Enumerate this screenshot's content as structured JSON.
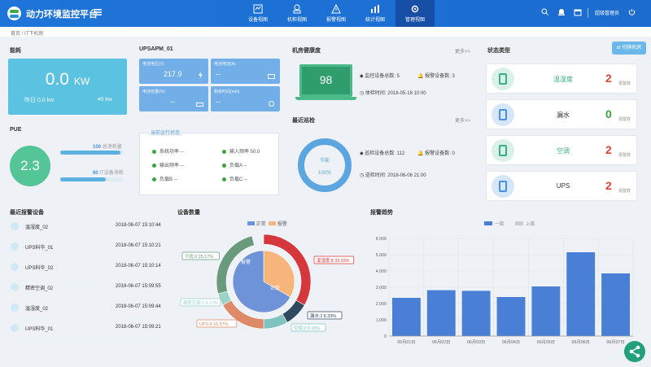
{
  "header": {
    "title": "动力环境监控平台",
    "user": "超级管理员",
    "nav": [
      {
        "label": "设备视图"
      },
      {
        "label": "机柜视图"
      },
      {
        "label": "报警视图"
      },
      {
        "label": "统计视图"
      },
      {
        "label": "管理视图"
      }
    ]
  },
  "breadcrumb": {
    "home": "首页",
    "current": "IT下机房"
  },
  "power": {
    "title": "能耗",
    "value": "0.0",
    "unit": "KW",
    "yesterday": "昨日 0.0 kw",
    "trend": "0 kw"
  },
  "pue": {
    "title": "PUE",
    "value": "2.3",
    "bar1_value": "100",
    "bar1_label": "总消耗量",
    "bar2_value": "80",
    "bar2_label": "IT设备消耗",
    "bar1_fill": 0.95,
    "bar2_fill": 0.72
  },
  "ups": {
    "title": "UPSAPM_01",
    "cells": [
      {
        "label": "电池电压(V)",
        "value": "217.9"
      },
      {
        "label": "电池电流(A)",
        "value": "--"
      },
      {
        "label": "电池容量(%)",
        "value": "--"
      },
      {
        "label": "剩余时间(min)",
        "value": "--"
      }
    ],
    "status_title": "当前运行状态",
    "status": [
      "系统功率 --",
      "输入频率 50.0",
      "输出频率 --",
      "负载A --",
      "负载B --",
      "负载C --"
    ]
  },
  "health": {
    "title": "机房健康度",
    "more": "更多>>",
    "score": "98",
    "monitor": "监控设备总数: 5",
    "alarm": "报警设备数: 3",
    "time": "体检时间: 2018-05-18 10:00"
  },
  "inspect": {
    "title": "最近巡检",
    "more": "更多>>",
    "center_label": "节能",
    "score": "100分",
    "total": "巡检设备总数: 112",
    "alarm": "报警设备数: 0",
    "time": "巡检时间: 2018-06-06 21:00"
  },
  "status": {
    "title": "状态类型",
    "switch": "切换机房",
    "items": [
      {
        "label": "温湿度",
        "count": "2",
        "unit": "报警数",
        "color": "#e3413a"
      },
      {
        "label": "漏水",
        "count": "0",
        "unit": "报警数",
        "color": "#3ba53b"
      },
      {
        "label": "空调",
        "count": "2",
        "unit": "报警数",
        "color": "#e3413a"
      },
      {
        "label": "UPS",
        "count": "2",
        "unit": "报警数",
        "color": "#e3413a"
      }
    ]
  },
  "alarms": {
    "title": "最近报警设备",
    "rows": [
      {
        "name": "温湿度_02",
        "time": "2018-06-07 15:10:44"
      },
      {
        "name": "UPS科华_01",
        "time": "2018-06-07 15:10:21"
      },
      {
        "name": "UPS科华_02",
        "time": "2018-06-07 15:10:14"
      },
      {
        "name": "精密空调_02",
        "time": "2018-06-07 15:09:55"
      },
      {
        "name": "温湿度_02",
        "time": "2018-06-07 15:09:44"
      },
      {
        "name": "UPS科华_01",
        "time": "2018-06-07 15:09:21"
      }
    ]
  },
  "device_count": {
    "title": "设备数量",
    "legend": [
      "正常",
      "报警"
    ],
    "inner": [
      {
        "label": "报警",
        "value": 33.33,
        "color": "#f7b47b"
      },
      {
        "label": "正常",
        "value": 66.67,
        "color": "#6f93d9"
      }
    ],
    "outer": [
      {
        "label": "温湿度:8 33.33%",
        "value": 33.33,
        "color": "#d6373d"
      },
      {
        "label": "漏水:2 8.33%",
        "value": 8.33,
        "color": "#2f4a5f"
      },
      {
        "label": "空调:2 8.33%",
        "value": 8.33,
        "color": "#7fc3c1"
      },
      {
        "label": "UPS:4 16.67%",
        "value": 16.67,
        "color": "#de8968"
      },
      {
        "label": "精密空调:1 4.17%",
        "value": 4.17,
        "color": "#9bd3c5"
      },
      {
        "label": "干扰:0 25.17%",
        "value": 25.17,
        "color": "#6a9a7c"
      }
    ]
  },
  "chart_data": {
    "type": "bar",
    "title": "报警趋势",
    "legend": [
      "一周",
      "上周"
    ],
    "categories": [
      "06月01日",
      "06月02日",
      "06月03日",
      "06月04日",
      "06月05日",
      "06月06日",
      "06月07日"
    ],
    "series": [
      {
        "name": "一周",
        "values": [
          2350,
          2820,
          2780,
          2400,
          3050,
          5150,
          3850
        ]
      }
    ],
    "ylim": [
      0,
      6000
    ],
    "yticks": [
      "0",
      "1,000",
      "2,000",
      "3,000",
      "4,000",
      "5,000",
      "6,000"
    ],
    "colors": [
      "#4a7fd6",
      "#cccccc"
    ]
  }
}
